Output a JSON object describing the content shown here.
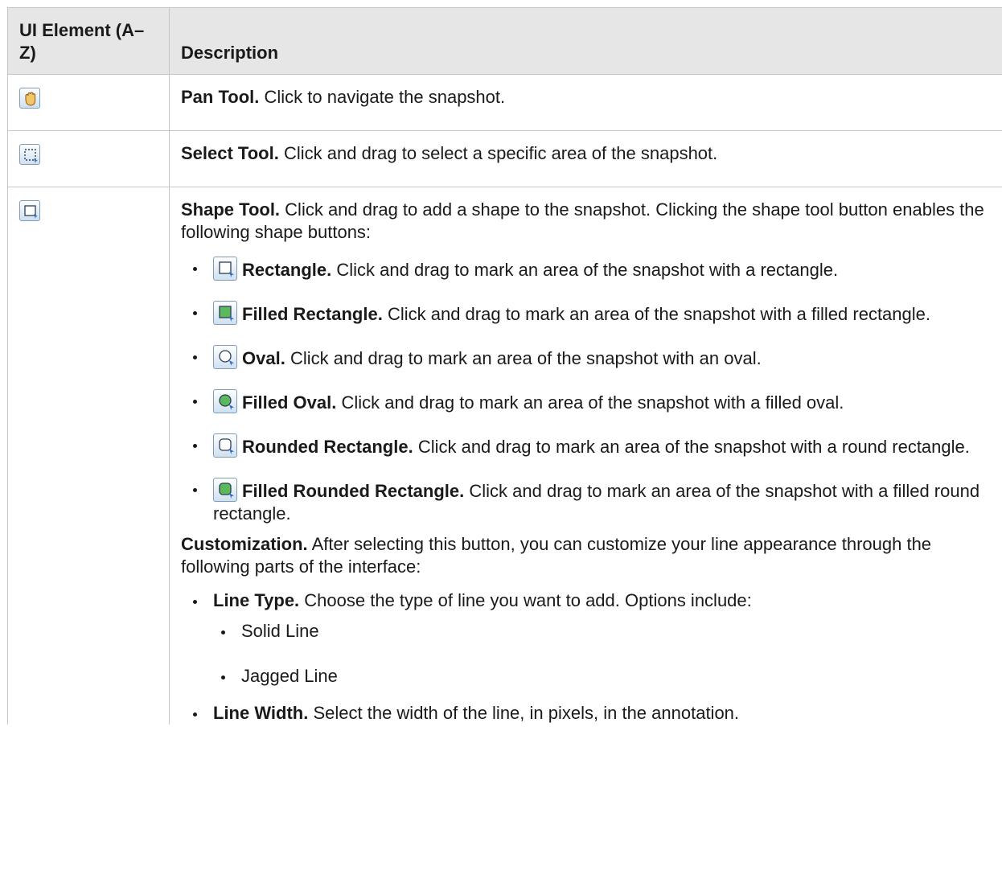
{
  "headers": {
    "element": "UI Element (A–Z)",
    "description": "Description"
  },
  "rows": {
    "pan": {
      "icon": "pan-hand-icon",
      "title": "Pan Tool.",
      "text": "Click to navigate the snapshot."
    },
    "select": {
      "icon": "select-tool-icon",
      "title": "Select Tool.",
      "text": "Click and drag to select a specific area of the snapshot."
    },
    "shape": {
      "icon": "shape-tool-icon",
      "title": "Shape Tool.",
      "text": "Click and drag to add a shape to the snapshot. Clicking the shape tool button enables the following shape buttons:",
      "items": [
        {
          "icon": "rectangle-icon",
          "title": "Rectangle.",
          "text": "Click and drag to mark an area of the snapshot with a rectangle."
        },
        {
          "icon": "filled-rectangle-icon",
          "title": "Filled Rectangle.",
          "text": "Click and drag to mark an area of the snapshot with a filled rectangle."
        },
        {
          "icon": "oval-icon",
          "title": "Oval.",
          "text": "Click and drag to mark an area of the snapshot with an oval."
        },
        {
          "icon": "filled-oval-icon",
          "title": "Filled Oval.",
          "text": "Click and drag to mark an area of the snapshot with a filled oval."
        },
        {
          "icon": "rounded-rectangle-icon",
          "title": "Rounded Rectangle.",
          "text": "Click and drag to mark an area of the snapshot with a round rectangle."
        },
        {
          "icon": "filled-rounded-rectangle-icon",
          "title": "Filled Rounded Rectangle.",
          "text": "Click and drag to mark an area of the snapshot with a filled round rectangle."
        }
      ],
      "customization": {
        "title": "Customization.",
        "text": "After selecting this button, you can customize your line appearance through the following parts of the interface:",
        "line_type": {
          "title": "Line Type.",
          "text": "Choose the type of line you want to add. Options include:",
          "options": [
            "Solid Line",
            "Jagged Line"
          ]
        },
        "line_width": {
          "title": "Line Width.",
          "text": "Select the width of the line, in pixels, in the annotation."
        }
      }
    }
  },
  "colors": {
    "header_bg": "#e6e6e6",
    "border": "#c6c6c6",
    "icon_border": "#7f9db9",
    "icon_green": "#5cb85c"
  }
}
